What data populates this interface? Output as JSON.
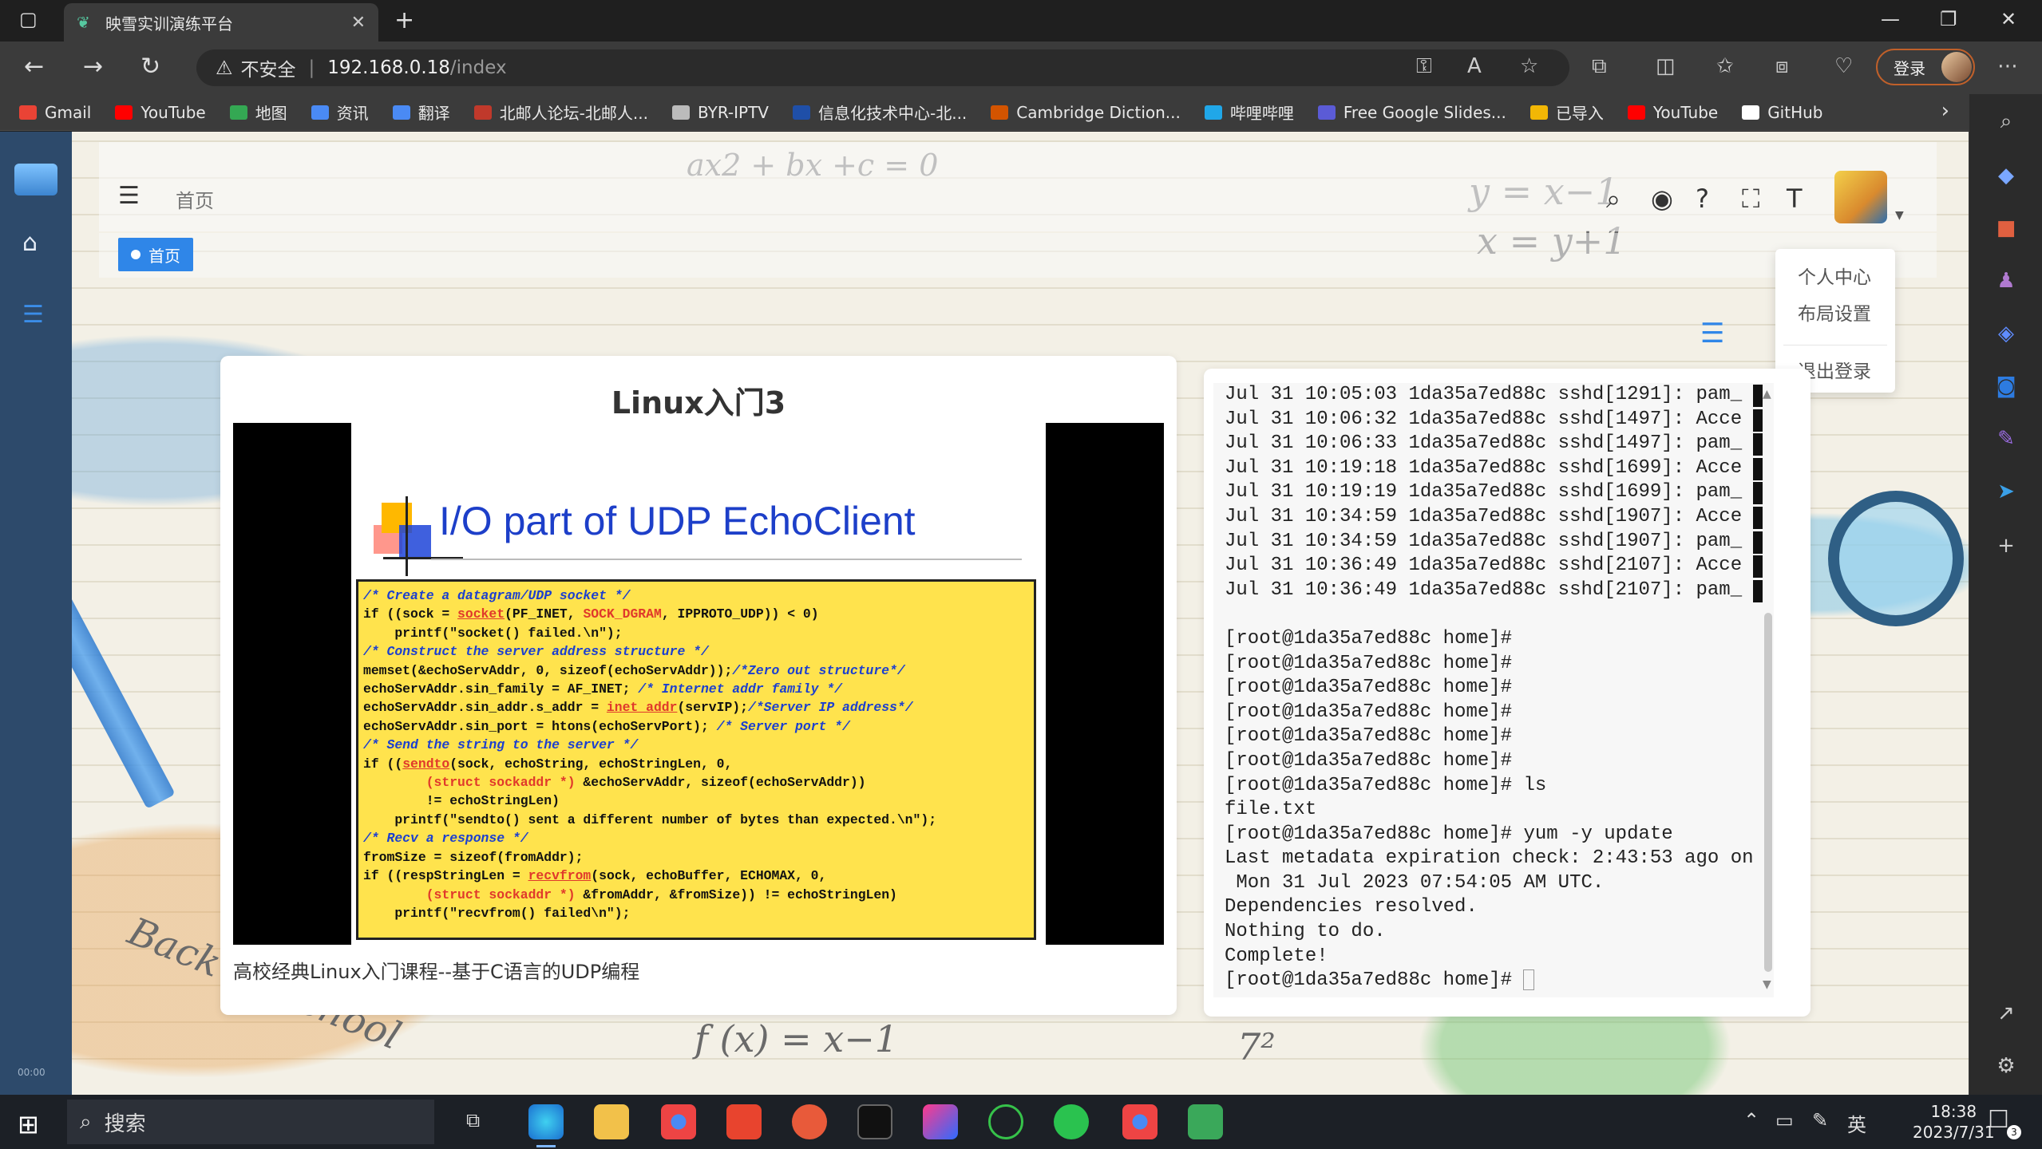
{
  "browser": {
    "tab_title": "映雪实训演练平台",
    "address_warning": "不安全",
    "address_host": "192.168.0.18",
    "address_path": "/index",
    "login_label": "登录",
    "bookmarks": [
      {
        "label": "Gmail",
        "color": "#ea4335"
      },
      {
        "label": "YouTube",
        "color": "#ff0000"
      },
      {
        "label": "地图",
        "color": "#34a853"
      },
      {
        "label": "资讯",
        "color": "#4a8af4"
      },
      {
        "label": "翻译",
        "color": "#4a8af4"
      },
      {
        "label": "北邮人论坛-北邮人...",
        "color": "#c0392b"
      },
      {
        "label": "BYR-IPTV",
        "color": "#bbbbbb"
      },
      {
        "label": "信息化技术中心-北...",
        "color": "#1f4fa8"
      },
      {
        "label": "Cambridge Diction...",
        "color": "#d35400"
      },
      {
        "label": "哔哩哔哩",
        "color": "#20a7e8"
      },
      {
        "label": "Free Google Slides...",
        "color": "#5b5bd6"
      },
      {
        "label": "已导入",
        "color": "#f2b705"
      },
      {
        "label": "YouTube",
        "color": "#ff0000"
      },
      {
        "label": "GitHub",
        "color": "#ffffff"
      }
    ]
  },
  "header": {
    "home_label": "首页",
    "tag_label": "首页"
  },
  "dropdown": {
    "items": [
      "个人中心",
      "布局设置",
      "退出登录"
    ]
  },
  "video_card": {
    "title": "Linux入门3",
    "slide_title": "I/O part of UDP EchoClient",
    "caption": "高校经典Linux入门课程--基于C语言的UDP编程"
  },
  "terminal": {
    "lines": [
      "Jul 31 10:05:03 1da35a7ed88c sshd[1291]: pam_",
      "Jul 31 10:06:32 1da35a7ed88c sshd[1497]: Acce",
      "Jul 31 10:06:33 1da35a7ed88c sshd[1497]: pam_",
      "Jul 31 10:19:18 1da35a7ed88c sshd[1699]: Acce",
      "Jul 31 10:19:19 1da35a7ed88c sshd[1699]: pam_",
      "Jul 31 10:34:59 1da35a7ed88c sshd[1907]: Acce",
      "Jul 31 10:34:59 1da35a7ed88c sshd[1907]: pam_",
      "Jul 31 10:36:49 1da35a7ed88c sshd[2107]: Acce",
      "Jul 31 10:36:49 1da35a7ed88c sshd[2107]: pam_",
      "",
      "[root@1da35a7ed88c home]#",
      "[root@1da35a7ed88c home]#",
      "[root@1da35a7ed88c home]#",
      "[root@1da35a7ed88c home]#",
      "[root@1da35a7ed88c home]#",
      "[root@1da35a7ed88c home]#",
      "[root@1da35a7ed88c home]# ls",
      "file.txt",
      "[root@1da35a7ed88c home]# yum -y update",
      "Last metadata expiration check: 2:43:53 ago on",
      " Mon 31 Jul 2023 07:54:05 AM UTC.",
      "Dependencies resolved.",
      "Nothing to do.",
      "Complete!"
    ],
    "prompt": "[root@1da35a7ed88c home]# "
  },
  "taskbar": {
    "search_label": "搜索",
    "ime_label": "英",
    "time": "18:38",
    "date": "2023/7/31",
    "notification_count": "3"
  },
  "sidebar_small": "00:00"
}
